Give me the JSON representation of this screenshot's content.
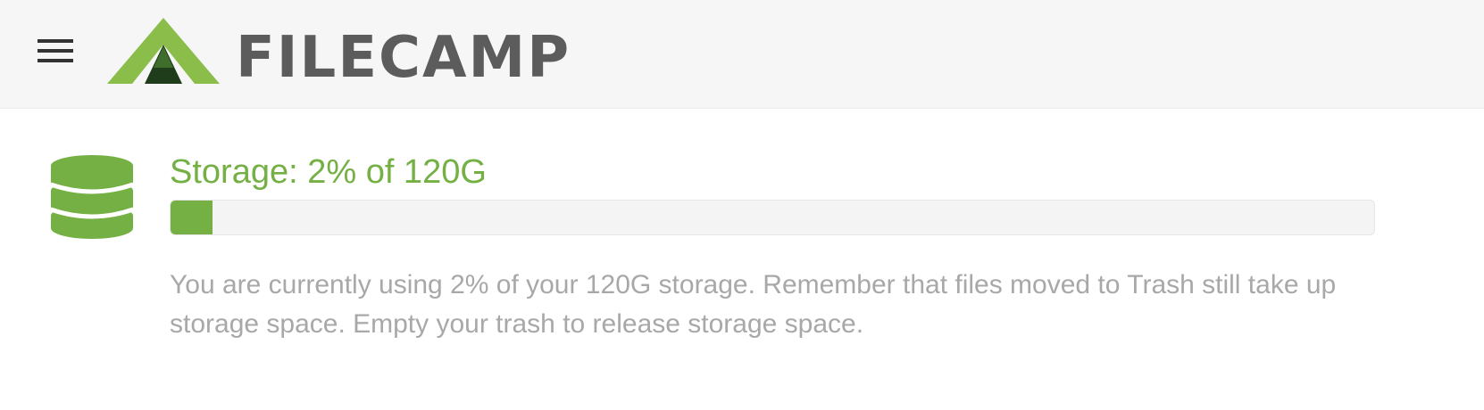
{
  "header": {
    "brand_name": "FILECAMP",
    "menu_icon": "hamburger-menu-icon",
    "logo_icon": "filecamp-mountain-logo"
  },
  "storage": {
    "icon": "database-icon",
    "title": "Storage: 2% of 120G",
    "usage_percent": 2,
    "progress_fraction": 0.035,
    "description": "You are currently using 2% of your 120G storage. Remember that files moved to Trash still take up storage space. Empty your trash to release storage space."
  },
  "colors": {
    "accent": "#74b044",
    "header_background": "#f6f6f6",
    "brand_text": "#5c5c5c",
    "description_text": "#a8a8a8",
    "progress_track": "#f4f4f4"
  }
}
